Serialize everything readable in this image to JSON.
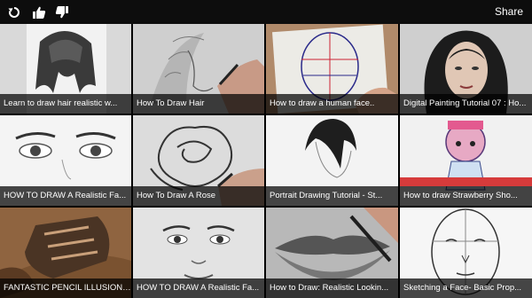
{
  "toolbar": {
    "icons": [
      "refresh-icon",
      "thumbs-up-icon",
      "thumbs-down-icon"
    ],
    "share_label": "Share"
  },
  "videos": [
    {
      "title": "Learn to draw hair realistic w..."
    },
    {
      "title": "How To Draw Hair"
    },
    {
      "title": "How to draw a human face.."
    },
    {
      "title": "Digital Painting Tutorial 07 : Ho..."
    },
    {
      "title": "HOW TO DRAW A Realistic Fa..."
    },
    {
      "title": "How To Draw A Rose"
    },
    {
      "title": "Portrait Drawing Tutorial - St..."
    },
    {
      "title": "How to draw Strawberry Sho..."
    },
    {
      "title": "FANTASTIC PENCIL ILLUSION!..."
    },
    {
      "title": "HOW TO DRAW A Realistic Fa..."
    },
    {
      "title": "How to Draw: Realistic Lookin..."
    },
    {
      "title": "Sketching a Face- Basic Prop..."
    }
  ]
}
